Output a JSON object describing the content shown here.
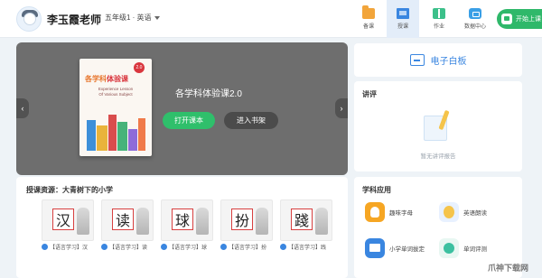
{
  "header": {
    "teacher_name": "李玉霞老师",
    "grade_select": "五年级1 · 英语",
    "nav": [
      {
        "label": "备课",
        "icon": "prepare-folder-icon"
      },
      {
        "label": "授课",
        "icon": "teach-screen-icon"
      },
      {
        "label": "作业",
        "icon": "homework-book-icon"
      },
      {
        "label": "数据中心",
        "icon": "data-center-icon"
      }
    ],
    "start_button": "开始上课"
  },
  "banner": {
    "course_title": "各学科体验课2.0",
    "open_button": "打开课本",
    "shelf_button": "进入书架",
    "book": {
      "title_part1": "各学科",
      "title_part2": "体验课",
      "badge": "2.0",
      "subtitle_line1": "Experience Lesson",
      "subtitle_line2": "Of Various Subject"
    }
  },
  "resources": {
    "title": "授课资源：大青树下的小学",
    "items": [
      {
        "char": "汉",
        "caption": "【语言学习】汉"
      },
      {
        "char": "读",
        "caption": "【语言学习】读"
      },
      {
        "char": "球",
        "caption": "【语言学习】球"
      },
      {
        "char": "扮",
        "caption": "【语言学习】扮"
      },
      {
        "char": "踐",
        "caption": "【语言学习】践"
      }
    ]
  },
  "whiteboard": {
    "label": "电子白板"
  },
  "evaluation": {
    "title": "讲评",
    "empty_text": "暂无讲评报告"
  },
  "apps": {
    "title": "学科应用",
    "items": [
      {
        "label": "趣味字母"
      },
      {
        "label": "英语朗读"
      },
      {
        "label": "小学单词拔定"
      },
      {
        "label": "单词评测"
      }
    ]
  },
  "watermark": "爪神下载网"
}
